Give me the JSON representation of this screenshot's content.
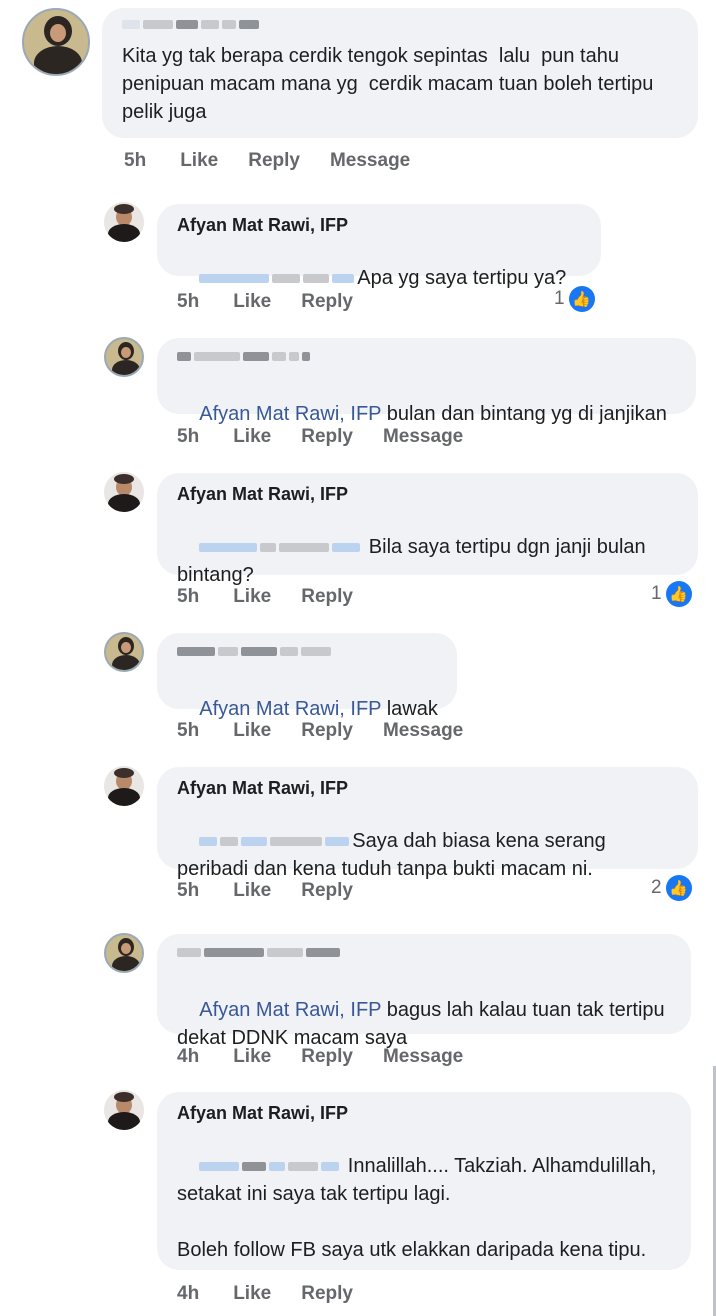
{
  "comments": [
    {
      "author": "",
      "mention": "",
      "text": "Kita yg tak berapa cerdik tengok sepintas  lalu  pun tahu penipuan macam mana yg  cerdik macam tuan boleh tertipu pelik juga",
      "time": "5h",
      "like": "Like",
      "reply": "Reply",
      "message": "Message",
      "reactions": ""
    },
    {
      "author": "Afyan Mat Rawi, IFP",
      "mention": "",
      "text": "Apa yg saya tertipu ya?",
      "time": "5h",
      "like": "Like",
      "reply": "Reply",
      "message": "",
      "reactions": "1"
    },
    {
      "author": "",
      "mention": "Afyan Mat Rawi, IFP",
      "text": " bulan dan bintang yg di janjikan",
      "time": "5h",
      "like": "Like",
      "reply": "Reply",
      "message": "Message",
      "reactions": ""
    },
    {
      "author": "Afyan Mat Rawi, IFP",
      "mention": "",
      "text": " Bila saya tertipu dgn janji bulan bintang?",
      "time": "5h",
      "like": "Like",
      "reply": "Reply",
      "message": "",
      "reactions": "1"
    },
    {
      "author": "",
      "mention": "Afyan Mat Rawi, IFP",
      "text": " lawak",
      "time": "5h",
      "like": "Like",
      "reply": "Reply",
      "message": "Message",
      "reactions": ""
    },
    {
      "author": "Afyan Mat Rawi, IFP",
      "mention": "",
      "text": "Saya dah biasa kena serang peribadi dan kena tuduh tanpa bukti macam ni.",
      "time": "5h",
      "like": "Like",
      "reply": "Reply",
      "message": "",
      "reactions": "2"
    },
    {
      "author": "",
      "mention": "Afyan Mat Rawi, IFP",
      "text": " bagus lah kalau tuan tak tertipu dekat DDNK macam saya",
      "time": "4h",
      "like": "Like",
      "reply": "Reply",
      "message": "Message",
      "reactions": ""
    },
    {
      "author": "Afyan Mat Rawi, IFP",
      "mention": "",
      "text": " Innalillah.... Takziah. Alhamdulillah, setakat ini saya tak tertipu lagi.\n\nBoleh follow FB saya utk elakkan daripada kena tipu.",
      "time": "4h",
      "like": "Like",
      "reply": "Reply",
      "message": "",
      "reactions": ""
    }
  ],
  "icons": {
    "reaction": "like-thumb-icon",
    "color_reaction": "#1877f2"
  }
}
